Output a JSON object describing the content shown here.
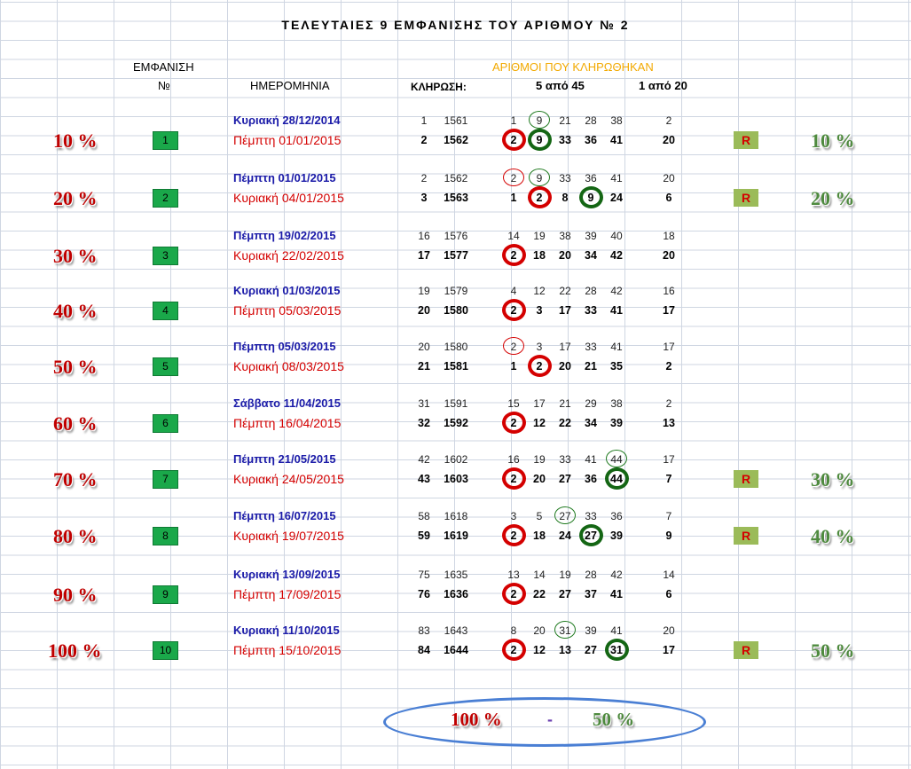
{
  "header": {
    "title": "ΤΕΛΕΥΤΑΙΕΣ 9 ΕΜΦΑΝΙΣΗΣ ΤΟΥ ΑΡΙΘΜΟΥ № 2",
    "col_appearance": "ΕΜΦΑΝΙΣΗ",
    "col_no": "№",
    "col_date": "ΗΜΕΡΟΜΗΝΙΑ",
    "col_draw": "ΚΛΗΡΩΣΗ:",
    "col_numbers": "ΑΡΙΘΜΟΙ ΠΟΥ ΚΛΗΡΩΘΗΚΑΝ",
    "col_5of45": "5 από 45",
    "col_1of20": "1 από 20"
  },
  "colors": {
    "red": "#d40000",
    "blue": "#1a1aa8",
    "green": "#1aa84a",
    "gold": "#f2a900",
    "r_badge_bg": "#9bbb59"
  },
  "blocks": [
    {
      "no": "1",
      "pct_left": "10 %",
      "r": "R",
      "pct_right": "10 %",
      "prev": {
        "date": "Κυριακή 28/12/2014",
        "idx": "1",
        "draw": "1561",
        "nums": [
          "1",
          "9",
          "21",
          "28",
          "38"
        ],
        "bonus": "2",
        "circles": [
          [
            1,
            "grn"
          ]
        ]
      },
      "cur": {
        "date": "Πέμπτη 01/01/2015",
        "idx": "2",
        "draw": "1562",
        "nums": [
          "2",
          "9",
          "33",
          "36",
          "41"
        ],
        "bonus": "20",
        "circles": [
          [
            0,
            "red"
          ],
          [
            1,
            "grn"
          ]
        ]
      }
    },
    {
      "no": "2",
      "pct_left": "20 %",
      "r": "R",
      "pct_right": "20 %",
      "prev": {
        "date": "Πέμπτη 01/01/2015",
        "idx": "2",
        "draw": "1562",
        "nums": [
          "2",
          "9",
          "33",
          "36",
          "41"
        ],
        "bonus": "20",
        "circles": [
          [
            0,
            "red"
          ],
          [
            1,
            "grn"
          ]
        ]
      },
      "cur": {
        "date": "Κυριακή 04/01/2015",
        "idx": "3",
        "draw": "1563",
        "nums": [
          "1",
          "2",
          "8",
          "9",
          "24"
        ],
        "bonus": "6",
        "circles": [
          [
            1,
            "red"
          ],
          [
            3,
            "grn"
          ]
        ]
      }
    },
    {
      "no": "3",
      "pct_left": "30 %",
      "r": "",
      "pct_right": "",
      "prev": {
        "date": "Πέμπτη 19/02/2015",
        "idx": "16",
        "draw": "1576",
        "nums": [
          "14",
          "19",
          "38",
          "39",
          "40"
        ],
        "bonus": "18",
        "circles": []
      },
      "cur": {
        "date": "Κυριακή 22/02/2015",
        "idx": "17",
        "draw": "1577",
        "nums": [
          "2",
          "18",
          "20",
          "34",
          "42"
        ],
        "bonus": "20",
        "circles": [
          [
            0,
            "red"
          ]
        ]
      }
    },
    {
      "no": "4",
      "pct_left": "40 %",
      "r": "",
      "pct_right": "",
      "prev": {
        "date": "Κυριακή 01/03/2015",
        "idx": "19",
        "draw": "1579",
        "nums": [
          "4",
          "12",
          "22",
          "28",
          "42"
        ],
        "bonus": "16",
        "circles": []
      },
      "cur": {
        "date": "Πέμπτη 05/03/2015",
        "idx": "20",
        "draw": "1580",
        "nums": [
          "2",
          "3",
          "17",
          "33",
          "41"
        ],
        "bonus": "17",
        "circles": [
          [
            0,
            "red"
          ]
        ]
      }
    },
    {
      "no": "5",
      "pct_left": "50 %",
      "r": "",
      "pct_right": "",
      "prev": {
        "date": "Πέμπτη 05/03/2015",
        "idx": "20",
        "draw": "1580",
        "nums": [
          "2",
          "3",
          "17",
          "33",
          "41"
        ],
        "bonus": "17",
        "circles": [
          [
            0,
            "red"
          ]
        ]
      },
      "cur": {
        "date": "Κυριακή 08/03/2015",
        "idx": "21",
        "draw": "1581",
        "nums": [
          "1",
          "2",
          "20",
          "21",
          "35"
        ],
        "bonus": "2",
        "circles": [
          [
            1,
            "red"
          ]
        ]
      }
    },
    {
      "no": "6",
      "pct_left": "60 %",
      "r": "",
      "pct_right": "",
      "prev": {
        "date": "Σάββατο 11/04/2015",
        "idx": "31",
        "draw": "1591",
        "nums": [
          "15",
          "17",
          "21",
          "29",
          "38"
        ],
        "bonus": "2",
        "circles": []
      },
      "cur": {
        "date": "Πέμπτη 16/04/2015",
        "idx": "32",
        "draw": "1592",
        "nums": [
          "2",
          "12",
          "22",
          "34",
          "39"
        ],
        "bonus": "13",
        "circles": [
          [
            0,
            "red"
          ]
        ]
      }
    },
    {
      "no": "7",
      "pct_left": "70 %",
      "r": "R",
      "pct_right": "30 %",
      "prev": {
        "date": "Πέμπτη 21/05/2015",
        "idx": "42",
        "draw": "1602",
        "nums": [
          "16",
          "19",
          "33",
          "41",
          "44"
        ],
        "bonus": "17",
        "circles": [
          [
            4,
            "grn"
          ]
        ]
      },
      "cur": {
        "date": "Κυριακή 24/05/2015",
        "idx": "43",
        "draw": "1603",
        "nums": [
          "2",
          "20",
          "27",
          "36",
          "44"
        ],
        "bonus": "7",
        "circles": [
          [
            0,
            "red"
          ],
          [
            4,
            "grn"
          ]
        ]
      }
    },
    {
      "no": "8",
      "pct_left": "80 %",
      "r": "R",
      "pct_right": "40 %",
      "prev": {
        "date": "Πέμπτη 16/07/2015",
        "idx": "58",
        "draw": "1618",
        "nums": [
          "3",
          "5",
          "27",
          "33",
          "36"
        ],
        "bonus": "7",
        "circles": [
          [
            2,
            "grn"
          ]
        ]
      },
      "cur": {
        "date": "Κυριακή 19/07/2015",
        "idx": "59",
        "draw": "1619",
        "nums": [
          "2",
          "18",
          "24",
          "27",
          "39"
        ],
        "bonus": "9",
        "circles": [
          [
            0,
            "red"
          ],
          [
            3,
            "grn"
          ]
        ]
      }
    },
    {
      "no": "9",
      "pct_left": "90 %",
      "r": "",
      "pct_right": "",
      "prev": {
        "date": "Κυριακή 13/09/2015",
        "idx": "75",
        "draw": "1635",
        "nums": [
          "13",
          "14",
          "19",
          "28",
          "42"
        ],
        "bonus": "14",
        "circles": []
      },
      "cur": {
        "date": "Πέμπτη 17/09/2015",
        "idx": "76",
        "draw": "1636",
        "nums": [
          "2",
          "22",
          "27",
          "37",
          "41"
        ],
        "bonus": "6",
        "circles": [
          [
            0,
            "red"
          ]
        ]
      }
    },
    {
      "no": "10",
      "pct_left": "100 %",
      "r": "R",
      "pct_right": "50 %",
      "prev": {
        "date": "Κυριακή 11/10/2015",
        "idx": "83",
        "draw": "1643",
        "nums": [
          "8",
          "20",
          "31",
          "39",
          "41"
        ],
        "bonus": "20",
        "circles": [
          [
            2,
            "grn"
          ]
        ]
      },
      "cur": {
        "date": "Πέμπτη 15/10/2015",
        "idx": "84",
        "draw": "1644",
        "nums": [
          "2",
          "12",
          "13",
          "27",
          "31"
        ],
        "bonus": "17",
        "circles": [
          [
            0,
            "red"
          ],
          [
            4,
            "grn"
          ]
        ]
      }
    }
  ],
  "summary": {
    "left": "100 %",
    "sep": "-",
    "right": "50 %"
  }
}
